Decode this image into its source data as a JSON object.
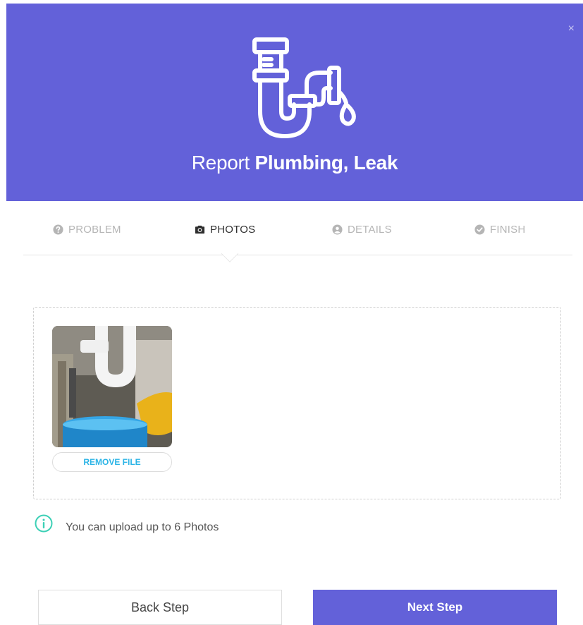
{
  "header": {
    "title_prefix": "Report",
    "title_bold": "Plumbing, Leak",
    "close_label": "×",
    "background_color": "#6361d9",
    "icon": "pipe-leak-icon"
  },
  "steps": [
    {
      "label": "PROBLEM",
      "icon": "question-circle-icon",
      "active": false
    },
    {
      "label": "PHOTOS",
      "icon": "camera-icon",
      "active": true
    },
    {
      "label": "DETAILS",
      "icon": "user-circle-icon",
      "active": false
    },
    {
      "label": "FINISH",
      "icon": "check-circle-icon",
      "active": false
    }
  ],
  "upload": {
    "remove_label": "REMOVE FILE",
    "info_text": "You can upload up to 6 Photos",
    "info_icon": "info-circle-icon",
    "accent_color": "#2bb4e6"
  },
  "footer": {
    "back_label": "Back Step",
    "next_label": "Next Step"
  }
}
